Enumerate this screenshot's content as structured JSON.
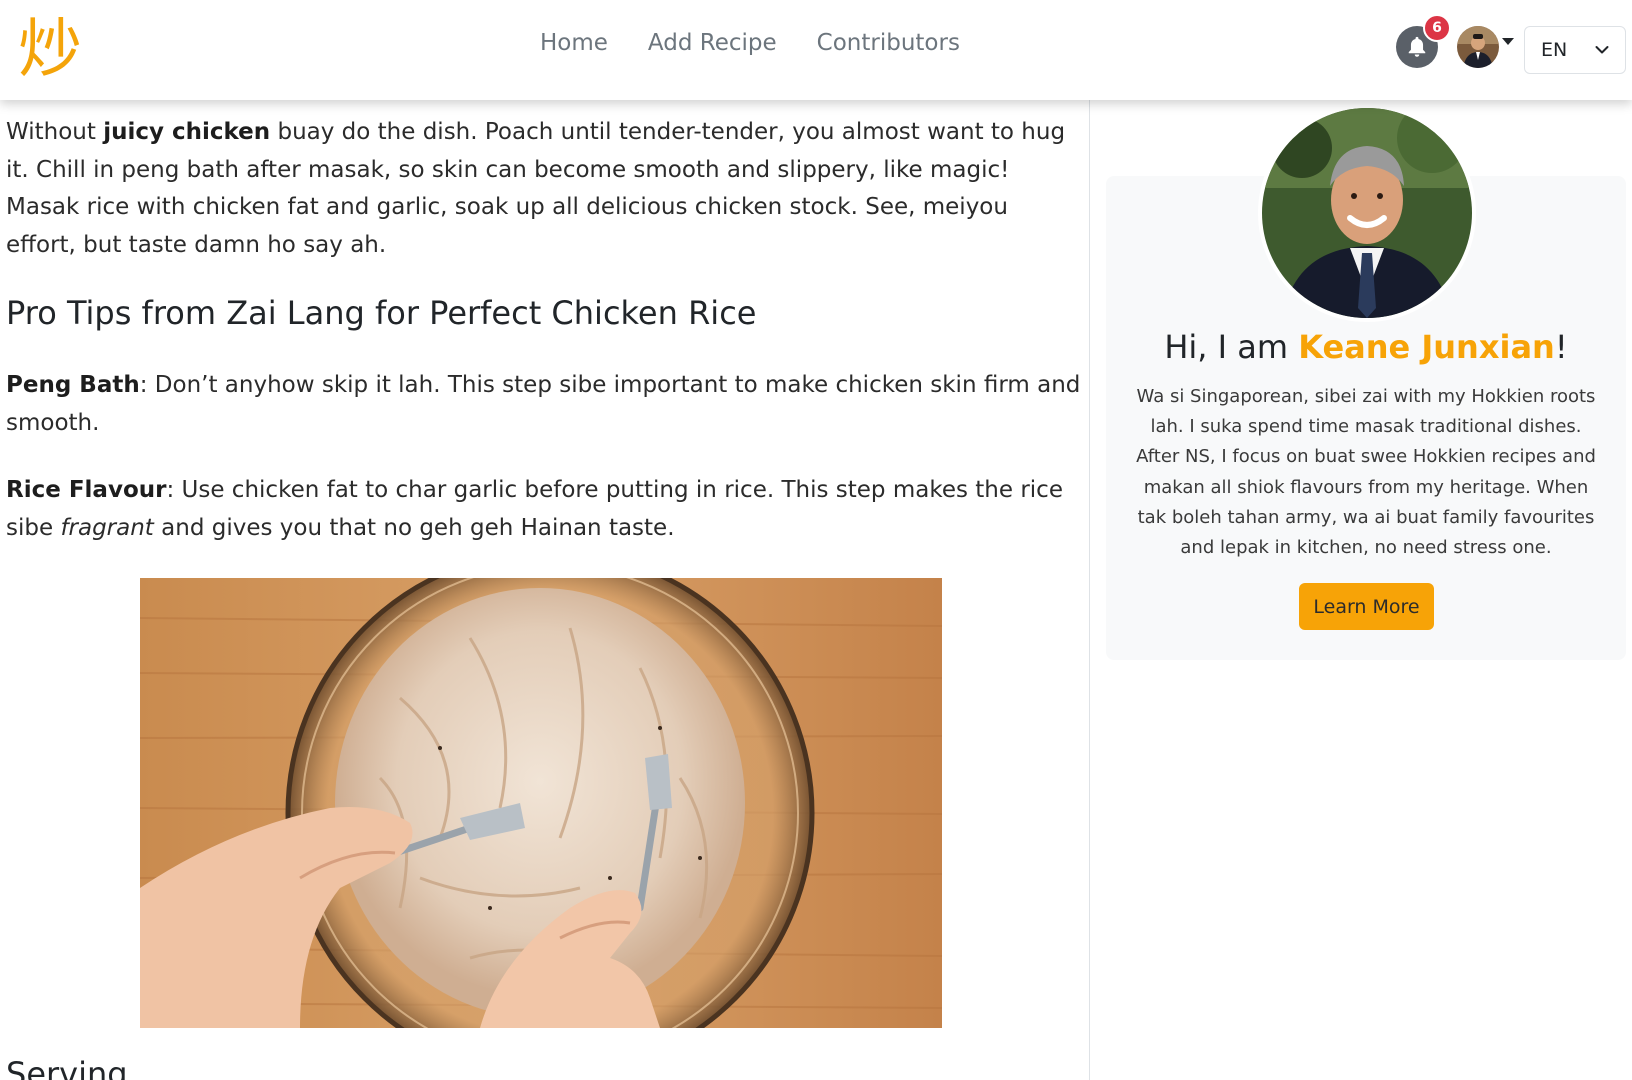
{
  "nav": {
    "logo_char": "炒",
    "links": [
      "Home",
      "Add Recipe",
      "Contributors"
    ],
    "notification_count": "6",
    "language": "EN"
  },
  "article": {
    "p1": {
      "before": "Without ",
      "bold": "juicy chicken",
      "after": " buay do the dish. Poach until tender-tender, you almost want to hug it. Chill in peng bath after masak, so skin can become smooth and slippery, like magic! Masak rice with chicken fat and garlic, soak up all delicious chicken stock. See, meiyou effort, but taste damn ho say ah."
    },
    "heading_tips": "Pro Tips from Zai Lang for Perfect Chicken Rice",
    "tip1": {
      "bold": "Peng Bath",
      "text": ": Don’t anyhow skip it lah. This step sibe important to make chicken skin firm and smooth."
    },
    "tip2": {
      "bold": "Rice Flavour",
      "text": ": Use chicken fat to char garlic before putting in rice. This step makes the rice sibe ",
      "italic": "fragrant",
      "text_after": " and gives you that no geh geh Hainan taste."
    },
    "heading_serving": "Serving"
  },
  "profile": {
    "greeting": "Hi, I am ",
    "name": "Keane Junxian",
    "exclaim": "!",
    "bio": "Wa si Singaporean, sibei zai with my Hokkien roots lah. I suka spend time masak traditional dishes. After NS, I focus on buat swee Hokkien recipes and makan all shiok flavours from my heritage. When tak boleh tahan army, wa ai buat family favourites and lepak in kitchen, no need stress one.",
    "button": "Learn More"
  },
  "colors": {
    "accent": "#f7a307",
    "badge": "#dc3545",
    "bell": "#5a6068"
  },
  "icons": [
    "bell-icon",
    "chevron-down-icon",
    "caret-down-icon"
  ]
}
